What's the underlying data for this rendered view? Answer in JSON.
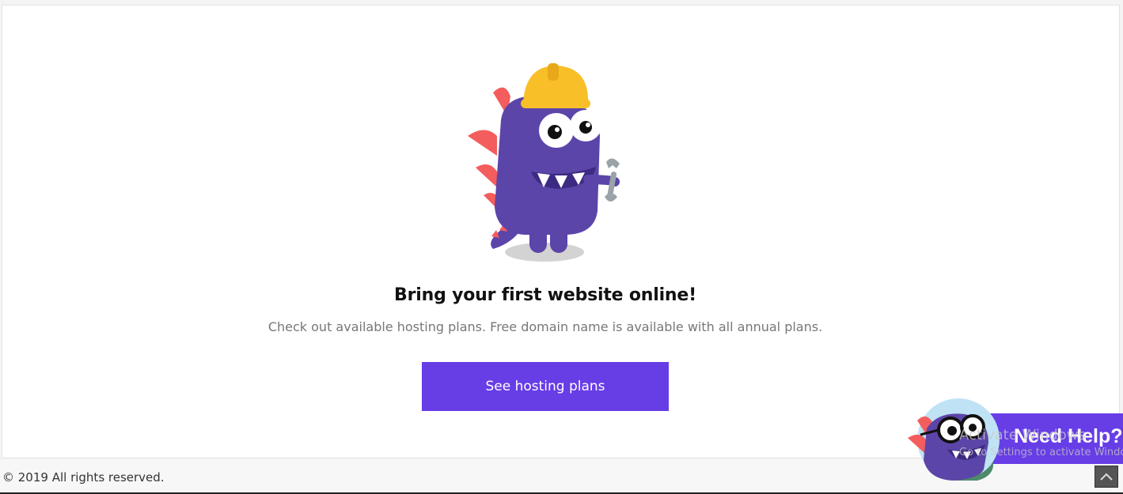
{
  "empty_state": {
    "title": "Bring your first website online!",
    "description": "Check out available hosting plans. Free domain name is available with all annual plans.",
    "cta_label": "See hosting plans"
  },
  "footer": {
    "copyright": "© 2019 All rights reserved."
  },
  "help_widget": {
    "label": "Need Help?"
  },
  "os_watermark": {
    "title": "Activate Windows",
    "subtitle": "Go to Settings to activate Windows."
  },
  "icons": {
    "mascot": "builder-monster-illustration",
    "help_avatar": "monster-with-glasses-avatar",
    "scroll_top": "chevron-up-icon"
  },
  "colors": {
    "brand_purple": "#673de6",
    "mascot_purple": "#5c45a8",
    "helmet_yellow": "#f9bf28",
    "spike_red": "#f45d5d"
  }
}
